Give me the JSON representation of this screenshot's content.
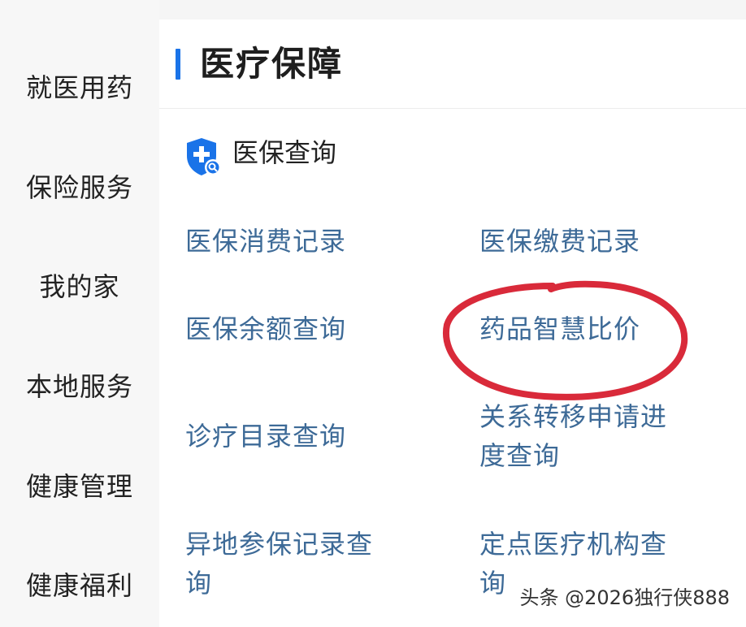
{
  "sidebar": {
    "items": [
      {
        "label": "就医用药"
      },
      {
        "label": "保险服务"
      },
      {
        "label": "我的家"
      },
      {
        "label": "本地服务"
      },
      {
        "label": "健康管理"
      },
      {
        "label": "健康福利"
      }
    ]
  },
  "section": {
    "title": "医疗保障",
    "subsection": {
      "title": "医保查询",
      "icon": "shield-plus-search-icon"
    },
    "links": [
      {
        "label": "医保消费记录"
      },
      {
        "label": "医保缴费记录"
      },
      {
        "label": "医保余额查询"
      },
      {
        "label": "药品智慧比价"
      },
      {
        "label": "诊疗目录查询"
      },
      {
        "label": "关系转移申请进度查询",
        "line1": "关系转移申请进",
        "line2": "度查询"
      },
      {
        "label": "异地参保记录查询",
        "line1": "异地参保记录查",
        "line2": "询"
      },
      {
        "label": "定点医疗机构查询",
        "line1": "定点医疗机构查",
        "line2": "询"
      }
    ]
  },
  "annotation": {
    "color": "#d92a3a",
    "target": "药品智慧比价"
  },
  "watermark": "头条 @2026独行侠888",
  "colors": {
    "accent": "#1a73e8",
    "link": "#3d6a97"
  }
}
